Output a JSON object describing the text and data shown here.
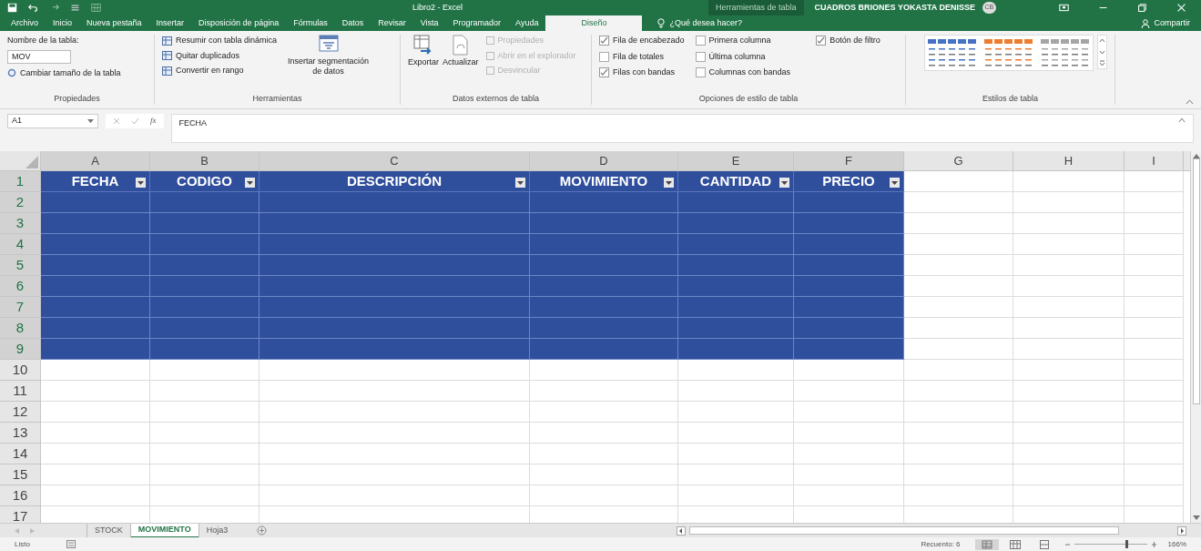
{
  "title_bar": {
    "title": "Libro2  -  Excel",
    "context_label": "Herramientas de tabla",
    "user": "CUADROS BRIONES YOKASTA DENISSE",
    "avatar": "CB"
  },
  "menu_tabs": [
    {
      "label": "Archivo",
      "selected": false
    },
    {
      "label": "Inicio",
      "selected": false
    },
    {
      "label": "Nueva pestaña",
      "selected": false
    },
    {
      "label": "Insertar",
      "selected": false
    },
    {
      "label": "Disposición de página",
      "selected": false
    },
    {
      "label": "Fórmulas",
      "selected": false
    },
    {
      "label": "Datos",
      "selected": false
    },
    {
      "label": "Revisar",
      "selected": false
    },
    {
      "label": "Vista",
      "selected": false
    },
    {
      "label": "Programador",
      "selected": false
    },
    {
      "label": "Ayuda",
      "selected": false
    },
    {
      "label": "Diseño",
      "selected": true
    }
  ],
  "tell_me": "¿Qué desea hacer?",
  "share": "Compartir",
  "ribbon": {
    "properties": {
      "label": "Nombre de la tabla:",
      "value": "MOV",
      "resize": "Cambiar tamaño de la tabla",
      "group": "Propiedades"
    },
    "tools": {
      "items": [
        "Resumir con tabla dinámica",
        "Quitar duplicados",
        "Convertir en rango"
      ],
      "slicer": [
        "Insertar segmentación",
        "de datos"
      ],
      "group": "Herramientas"
    },
    "external": {
      "big": [
        "Exportar",
        "Actualizar"
      ],
      "items": [
        {
          "label": "Propiedades",
          "disabled": true
        },
        {
          "label": "Abrir en el explorador",
          "disabled": true
        },
        {
          "label": "Desvincular",
          "disabled": true
        }
      ],
      "group": "Datos externos de tabla"
    },
    "style_options": {
      "columns": [
        [
          {
            "label": "Fila de encabezado",
            "checked": true
          },
          {
            "label": "Fila de totales",
            "checked": false
          },
          {
            "label": "Filas con bandas",
            "checked": true
          }
        ],
        [
          {
            "label": "Primera columna",
            "checked": false
          },
          {
            "label": "Última columna",
            "checked": false
          },
          {
            "label": "Columnas con bandas",
            "checked": false
          }
        ],
        [
          {
            "label": "Botón de filtro",
            "checked": true
          }
        ]
      ],
      "group": "Opciones de estilo de tabla"
    },
    "styles": {
      "swatches": [
        {
          "color": "#4472c4"
        },
        {
          "color": "#ed7d31"
        },
        {
          "color": "#a5a5a5"
        }
      ],
      "group": "Estilos de tabla"
    }
  },
  "formula_bar": {
    "name_box": "A1",
    "function_icon": "fx",
    "value": "FECHA"
  },
  "columns": [
    "A",
    "B",
    "C",
    "D",
    "E",
    "F",
    "G",
    "H",
    "I"
  ],
  "table_headers": [
    "FECHA",
    "CODIGO",
    "DESCRIPCIÓN",
    "MOVIMIENTO",
    "CANTIDAD",
    "PRECIO"
  ],
  "rows": [
    "1",
    "2",
    "3",
    "4",
    "5",
    "6",
    "7",
    "8",
    "9",
    "10",
    "11",
    "12",
    "13",
    "14",
    "15",
    "16",
    "17"
  ],
  "sheet_tabs": [
    {
      "label": "STOCK",
      "selected": false
    },
    {
      "label": "MOVIMIENTO",
      "selected": true
    },
    {
      "label": "Hoja3",
      "selected": false
    }
  ],
  "status": {
    "mode": "Listo",
    "count": "Recuento: 6",
    "zoom": "166%",
    "zoom_slider": {
      "level": 0.72
    }
  }
}
